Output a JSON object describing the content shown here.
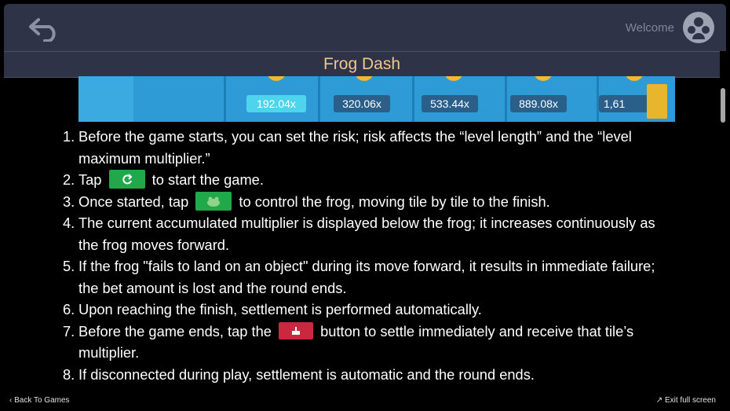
{
  "header": {
    "welcome": "Welcome",
    "title": "Frog Dash"
  },
  "banner": {
    "multipliers": [
      "192.04x",
      "320.06x",
      "533.44x",
      "889.08x",
      "1,61"
    ]
  },
  "rules": [
    {
      "num": "1.",
      "text": "Before the game starts, you can set the risk; risk affects the “level length” and the “level maximum multiplier.”"
    },
    {
      "num": "2.",
      "before": "Tap",
      "after": "to start the game.",
      "icon": "refresh-icon"
    },
    {
      "num": "3.",
      "before": "Once started, tap",
      "after": "to control the frog, moving tile by tile to the finish.",
      "icon": "frog-icon"
    },
    {
      "num": "4.",
      "text": "The current accumulated multiplier is displayed below the frog; it increases continuously as the frog moves forward."
    },
    {
      "num": "5.",
      "text": "If the frog \"fails to land on an object\" during its move forward, it results in immediate failure; the bet amount is lost and the round ends."
    },
    {
      "num": "6.",
      "text": "Upon reaching the finish, settlement is performed automatically."
    },
    {
      "num": "7.",
      "before": "Before the game ends, tap the",
      "after": "button to settle immediately and receive that tile’s multiplier.",
      "icon": "cashout-icon"
    },
    {
      "num": "8.",
      "text": "If disconnected during play, settlement is automatic and the round ends."
    }
  ],
  "footer": {
    "back": "Back To Games",
    "exit": "Exit full screen"
  },
  "colors": {
    "accent_title": "#f0c78a",
    "header_bg": "#2e3347",
    "green_button": "#20a84a",
    "red_button": "#c9283e"
  }
}
